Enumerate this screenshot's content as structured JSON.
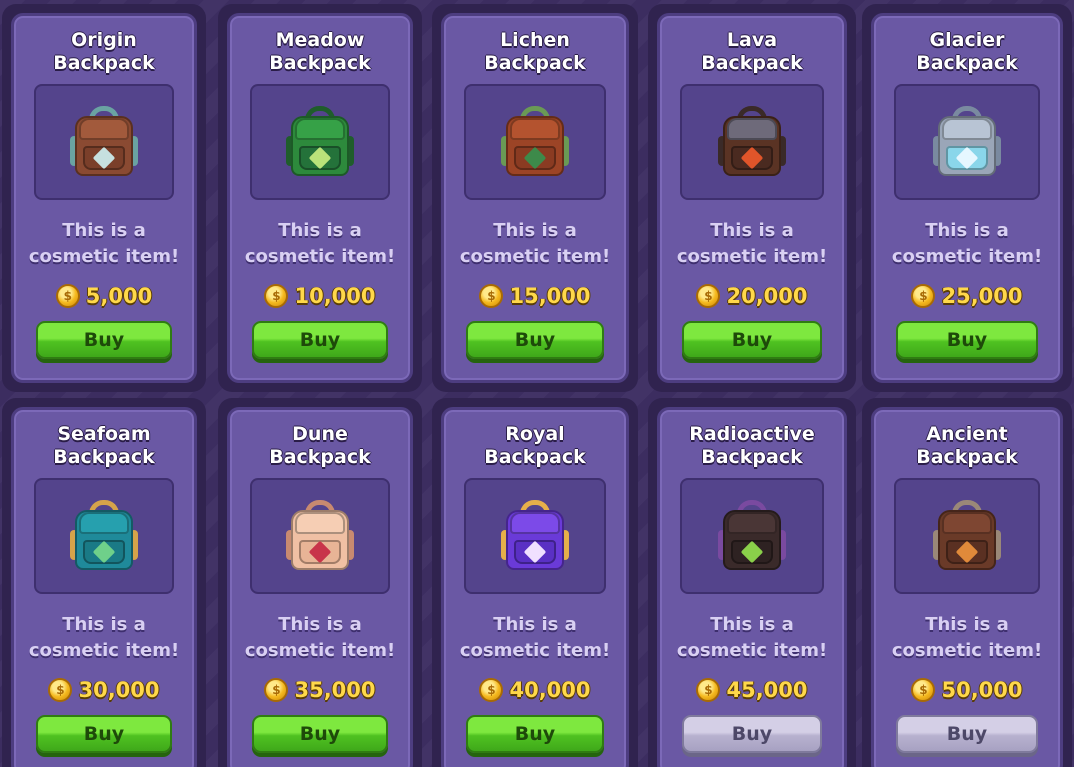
{
  "shop": {
    "description": "This is a cosmetic item!",
    "items": [
      {
        "name": "Origin Backpack",
        "line1": "This is a",
        "line2": "cosmetic item!",
        "price": "5,000",
        "buy": "Buy",
        "state": "enabled",
        "icon": "backpack-icon",
        "colors": {
          "main": "#8a4a32",
          "flap": "#a25a3c",
          "pocket": "#7a3f2a",
          "strap": "#6aa3a2",
          "emblem": "#c6e0df"
        }
      },
      {
        "name": "Meadow Backpack",
        "line1": "This is a",
        "line2": "cosmetic item!",
        "price": "10,000",
        "buy": "Buy",
        "state": "enabled",
        "icon": "backpack-icon",
        "colors": {
          "main": "#2d8a3c",
          "flap": "#36a147",
          "pocket": "#24723a",
          "strap": "#1f5d2b",
          "emblem": "#b9e27a"
        }
      },
      {
        "name": "Lichen Backpack",
        "line1": "This is a",
        "line2": "cosmetic item!",
        "price": "15,000",
        "buy": "Buy",
        "state": "enabled",
        "icon": "backpack-icon",
        "colors": {
          "main": "#9c4426",
          "flap": "#b4532f",
          "pocket": "#8a3b22",
          "strap": "#6a9a55",
          "emblem": "#3d8a4a"
        }
      },
      {
        "name": "Lava Backpack",
        "line1": "This is a",
        "line2": "cosmetic item!",
        "price": "20,000",
        "buy": "Buy",
        "state": "enabled",
        "icon": "backpack-icon",
        "colors": {
          "main": "#5a3324",
          "flap": "#6e6a7a",
          "pocket": "#4a2a20",
          "strap": "#3a2a28",
          "emblem": "#e0552a"
        }
      },
      {
        "name": "Glacier Backpack",
        "line1": "This is a",
        "line2": "cosmetic item!",
        "price": "25,000",
        "buy": "Buy",
        "state": "enabled",
        "icon": "backpack-icon",
        "colors": {
          "main": "#9aa6b8",
          "flap": "#b8c4d4",
          "pocket": "#8ad6ea",
          "strap": "#7a8aa0",
          "emblem": "#e6f7ff"
        }
      },
      {
        "name": "Seafoam Backpack",
        "line1": "This is a",
        "line2": "cosmetic item!",
        "price": "30,000",
        "buy": "Buy",
        "state": "enabled",
        "icon": "backpack-icon",
        "colors": {
          "main": "#1f8a9a",
          "flap": "#26a0ae",
          "pocket": "#1a7a86",
          "strap": "#d6a34a",
          "emblem": "#6fd08a"
        }
      },
      {
        "name": "Dune Backpack",
        "line1": "This is a",
        "line2": "cosmetic item!",
        "price": "35,000",
        "buy": "Buy",
        "state": "enabled",
        "icon": "backpack-icon",
        "colors": {
          "main": "#f0c0a4",
          "flap": "#f6ceb4",
          "pocket": "#e8b496",
          "strap": "#c88a70",
          "emblem": "#c8344a"
        }
      },
      {
        "name": "Royal Backpack",
        "line1": "This is a",
        "line2": "cosmetic item!",
        "price": "40,000",
        "buy": "Buy",
        "state": "enabled",
        "icon": "backpack-icon",
        "colors": {
          "main": "#6a3ad8",
          "flap": "#7c4ae8",
          "pocket": "#5a30c4",
          "strap": "#e6b04a",
          "emblem": "#f0e0ff"
        }
      },
      {
        "name": "Radioactive Backpack",
        "line1": "This is a",
        "line2": "cosmetic item!",
        "price": "45,000",
        "buy": "Buy",
        "state": "disabled",
        "icon": "backpack-icon",
        "colors": {
          "main": "#3a2a2a",
          "flap": "#4a3636",
          "pocket": "#2e2222",
          "strap": "#7a4aa0",
          "emblem": "#8ad04a"
        }
      },
      {
        "name": "Ancient Backpack",
        "line1": "This is a",
        "line2": "cosmetic item!",
        "price": "50,000",
        "buy": "Buy",
        "state": "disabled",
        "icon": "backpack-icon",
        "colors": {
          "main": "#6a3a28",
          "flap": "#7e4632",
          "pocket": "#5a3022",
          "strap": "#9a8878",
          "emblem": "#e08a3a"
        }
      }
    ]
  }
}
